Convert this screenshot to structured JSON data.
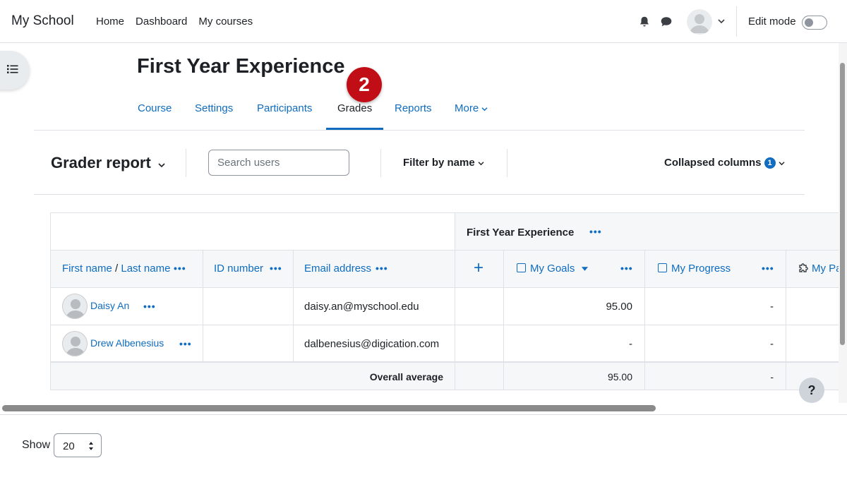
{
  "navbar": {
    "brand": "My School",
    "links": [
      "Home",
      "Dashboard",
      "My courses"
    ],
    "edit_mode_label": "Edit mode",
    "icons": [
      "bell-icon",
      "chat-icon",
      "avatar",
      "chevron-down-icon"
    ]
  },
  "page": {
    "title": "First Year Experience",
    "step_badge": "2"
  },
  "tabs": {
    "course": "Course",
    "settings": "Settings",
    "participants": "Participants",
    "grades": "Grades",
    "reports": "Reports",
    "more": "More",
    "active": "Grades"
  },
  "actionbar": {
    "report_title": "Grader report",
    "search_placeholder": "Search users",
    "filter_label": "Filter by name",
    "collapsed_label": "Collapsed columns",
    "collapsed_count": "1"
  },
  "table": {
    "category_header": "First Year Experience",
    "col_first_name": "First name",
    "col_separator": "/",
    "col_last_name": "Last name",
    "col_id": "ID number",
    "col_email": "Email address",
    "col_add": "+",
    "col_goals": "My Goals",
    "col_progress": "My Progress",
    "col_partial": "My Pa",
    "dots": "•••",
    "rows": [
      {
        "name": "Daisy An",
        "email": "daisy.an@myschool.edu",
        "goals": "95.00",
        "progress": "-"
      },
      {
        "name": "Drew Albenesius",
        "email": "dalbenesius@digication.com",
        "goals": "-",
        "progress": "-"
      }
    ],
    "average_label": "Overall average",
    "average_goals": "95.00",
    "average_progress": "-"
  },
  "help": "?",
  "footer": {
    "show_label": "Show",
    "show_value": "20"
  },
  "colors": {
    "link": "#0f6cbf",
    "badge_red": "#c10d16",
    "header_bg": "#f5f7f9"
  }
}
